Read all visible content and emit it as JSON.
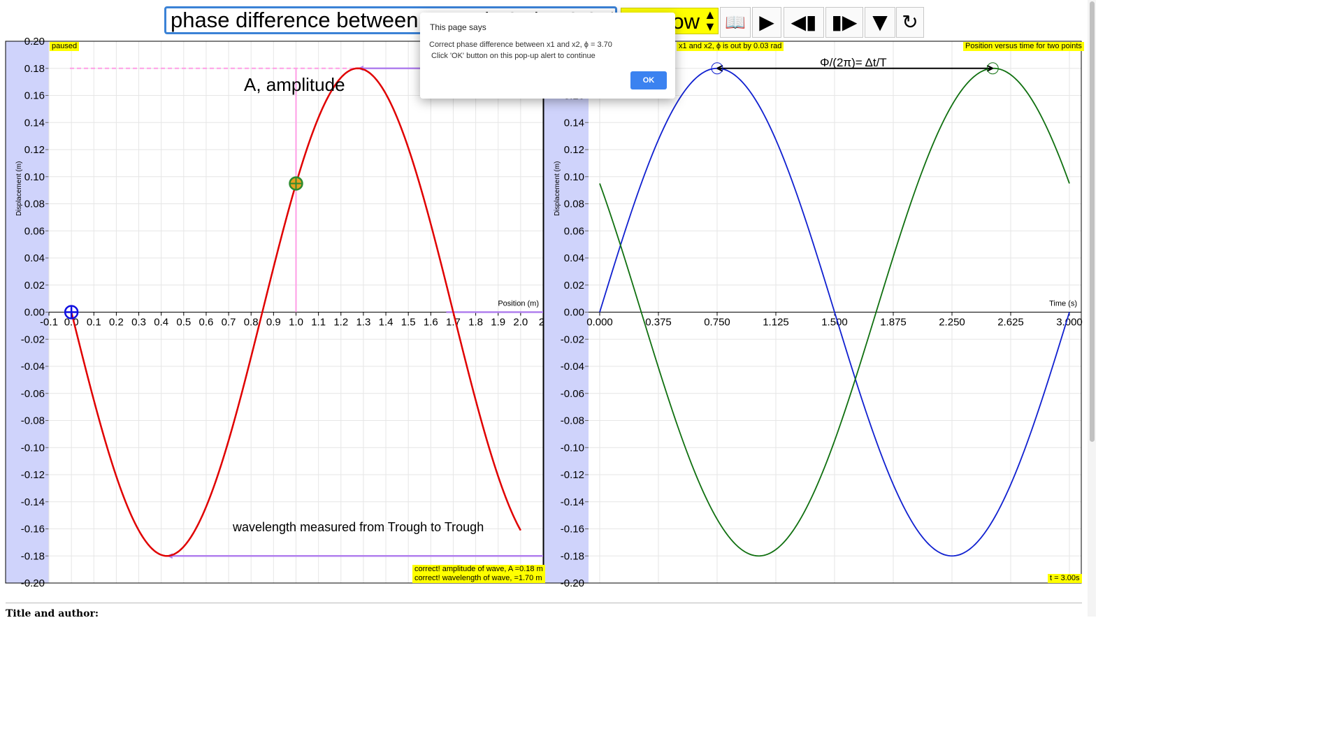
{
  "toolbar": {
    "question_value": "phase difference between x1 and x2, ϕ = 3.67 rad",
    "select_value": "Show",
    "book_glyph": "📖",
    "play_glyph": "▶",
    "step_back_glyph": "◀▮",
    "step_fwd_glyph": "▮▶",
    "down_glyph": "▼",
    "reset_glyph": "↻"
  },
  "left_plot": {
    "xlabel": "Position (m)",
    "ylabel": "Displacement (m)",
    "xlim": [
      -0.1,
      2.1
    ],
    "ylim": [
      -0.2,
      0.2
    ],
    "x_ticks": [
      "-0.1",
      "0.0",
      "0.1",
      "0.2",
      "0.3",
      "0.4",
      "0.5",
      "0.6",
      "0.7",
      "0.8",
      "0.9",
      "1.0",
      "1.1",
      "1.2",
      "1.3",
      "1.4",
      "1.5",
      "1.6",
      "1.7",
      "1.8",
      "1.9",
      "2.0",
      "2."
    ],
    "y_ticks": [
      "0.20",
      "0.18",
      "0.16",
      "0.14",
      "0.12",
      "0.10",
      "0.08",
      "0.06",
      "0.04",
      "0.02",
      "0.00",
      "-0.02",
      "-0.04",
      "-0.06",
      "-0.08",
      "-0.10",
      "-0.12",
      "-0.14",
      "-0.16",
      "-0.18",
      "-0.20"
    ],
    "status": "paused",
    "amplitude_label": "A, amplitude",
    "wavelength_label": "wavelength measured from Trough to Trough",
    "feedback_amplitude": "correct! amplitude of wave, A =0.18 m",
    "feedback_wavelength": "correct! wavelength of wave, =1.70 m"
  },
  "right_plot": {
    "xlabel": "Time (s)",
    "ylabel": "Displacement (m)",
    "xlim": [
      0,
      3.0
    ],
    "ylim": [
      -0.2,
      0.2
    ],
    "x_ticks": [
      "0.000",
      "0.375",
      "0.750",
      "1.125",
      "1.500",
      "1.875",
      "2.250",
      "2.625",
      "3.000"
    ],
    "y_ticks": [
      "0.20",
      "0.18",
      "0.16",
      "0.14",
      "0.12",
      "0.10",
      "0.08",
      "0.06",
      "0.04",
      "0.02",
      "0.00",
      "-0.02",
      "-0.04",
      "-0.06",
      "-0.08",
      "-0.10",
      "-0.12",
      "-0.14",
      "-0.16",
      "-0.18",
      "-0.20"
    ],
    "phase_error_tag": "x1 and x2, ϕ is out by 0.03 rad",
    "title_tag": "Position versus time for two points",
    "formula": "Φ/(2π)= Δt/T",
    "time_tag": "t = 3.00s"
  },
  "chart_data": [
    {
      "type": "line",
      "title": "",
      "xlabel": "Position (m)",
      "ylabel": "Displacement (m)",
      "xlim": [
        -0.1,
        2.1
      ],
      "ylim": [
        -0.2,
        0.2
      ],
      "grid": true,
      "series": [
        {
          "color": "#e00000",
          "amplitude": 0.18,
          "wavelength": 1.7,
          "x_range": [
            0.0,
            2.0
          ],
          "y_at_x0": 0.0,
          "initial_direction": "down"
        }
      ],
      "markers": [
        {
          "color": "#1010e0",
          "x": 0.0,
          "y": 0.0
        },
        {
          "color": "#2e8b2e",
          "x": 1.0,
          "y": 0.095
        }
      ]
    },
    {
      "type": "line",
      "title": "Position versus time for two points",
      "xlabel": "Time (s)",
      "ylabel": "Displacement (m)",
      "xlim": [
        0,
        3.0
      ],
      "ylim": [
        -0.2,
        0.2
      ],
      "grid": true,
      "series": [
        {
          "color": "#1020d0",
          "amplitude": 0.18,
          "period": 3.0,
          "x_range": [
            0.0,
            3.0
          ],
          "y_at_t0": 0.0,
          "initial_direction": "up"
        },
        {
          "color": "#107010",
          "amplitude": 0.18,
          "period": 3.0,
          "x_range": [
            0.0,
            3.0
          ],
          "y_at_t0": 0.095,
          "initial_direction": "down"
        }
      ],
      "peak_markers": [
        {
          "color": "#1020d0",
          "t": 0.75,
          "y": 0.18
        },
        {
          "color": "#107010",
          "t": 2.51,
          "y": 0.18
        }
      ]
    }
  ],
  "dialog": {
    "title": "This page says",
    "message": "Correct phase difference between x1 and x2, ϕ = 3.70\n Click 'OK' button on this pop-up alert to continue",
    "ok_label": "OK"
  },
  "footer": {
    "heading": "Title and author:"
  }
}
